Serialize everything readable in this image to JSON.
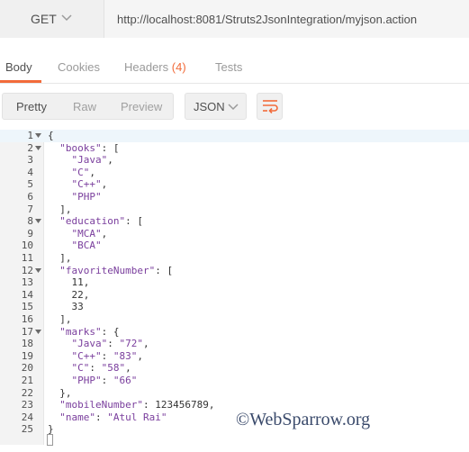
{
  "request": {
    "method": "GET",
    "url": "http://localhost:8081/Struts2JsonIntegration/myjson.action"
  },
  "tabs": [
    {
      "label": "Body",
      "active": true
    },
    {
      "label": "Cookies",
      "active": false
    },
    {
      "label": "Headers",
      "count": "(4)",
      "active": false
    },
    {
      "label": "Tests",
      "active": false
    }
  ],
  "view_modes": [
    "Pretty",
    "Raw",
    "Preview"
  ],
  "format": "JSON",
  "icons": {
    "method_dropdown": "chevron-down-icon",
    "format_dropdown": "chevron-down-icon",
    "wrap": "wrap-lines-icon",
    "fold": "fold-arrow-icon"
  },
  "colors": {
    "accent": "#f26b3a",
    "json_key": "#7a3e9d"
  },
  "code_lines": [
    {
      "n": "1",
      "t": "{"
    },
    {
      "n": "2",
      "t": "  \"books\": ["
    },
    {
      "n": "3",
      "t": "    \"Java\","
    },
    {
      "n": "4",
      "t": "    \"C\","
    },
    {
      "n": "5",
      "t": "    \"C++\","
    },
    {
      "n": "6",
      "t": "    \"PHP\""
    },
    {
      "n": "7",
      "t": "  ],"
    },
    {
      "n": "8",
      "t": "  \"education\": ["
    },
    {
      "n": "9",
      "t": "    \"MCA\","
    },
    {
      "n": "10",
      "t": "    \"BCA\""
    },
    {
      "n": "11",
      "t": "  ],"
    },
    {
      "n": "12",
      "t": "  \"favoriteNumber\": ["
    },
    {
      "n": "13",
      "t": "    11,"
    },
    {
      "n": "14",
      "t": "    22,"
    },
    {
      "n": "15",
      "t": "    33"
    },
    {
      "n": "16",
      "t": "  ],"
    },
    {
      "n": "17",
      "t": "  \"marks\": {"
    },
    {
      "n": "18",
      "t": "    \"Java\": \"72\","
    },
    {
      "n": "19",
      "t": "    \"C++\": \"83\","
    },
    {
      "n": "20",
      "t": "    \"C\": \"58\","
    },
    {
      "n": "21",
      "t": "    \"PHP\": \"66\""
    },
    {
      "n": "22",
      "t": "  },"
    },
    {
      "n": "23",
      "t": "  \"mobileNumber\": 123456789,"
    },
    {
      "n": "24",
      "t": "  \"name\": \"Atul Rai\""
    },
    {
      "n": "25",
      "t": "}"
    }
  ],
  "foldable_lines": [
    "1",
    "2",
    "8",
    "12",
    "17"
  ],
  "watermark": "©WebSparrow.org"
}
